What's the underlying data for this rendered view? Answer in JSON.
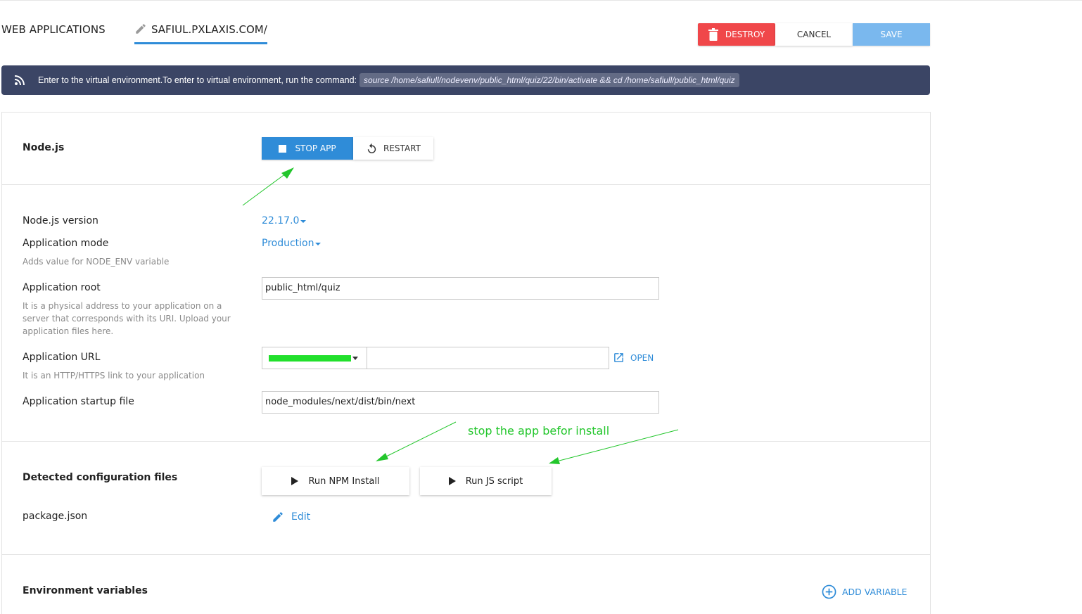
{
  "header": {
    "breadcrumb": "WEB APPLICATIONS",
    "domain": "SAFIUL.PXLAXIS.COM/",
    "destroy_label": "DESTROY",
    "cancel_label": "CANCEL",
    "save_label": "SAVE"
  },
  "banner": {
    "text": "Enter to the virtual environment.To enter to virtual environment, run the command:",
    "command": "source /home/safiull/nodevenv/public_html/quiz/22/bin/activate && cd /home/safiull/public_html/quiz"
  },
  "nodejs": {
    "title": "Node.js",
    "stop_label": "STOP APP",
    "restart_label": "RESTART"
  },
  "form": {
    "version_label": "Node.js version",
    "version_value": "22.17.0",
    "mode_label": "Application mode",
    "mode_value": "Production",
    "mode_hint": "Adds value for NODE_ENV variable",
    "root_label": "Application root",
    "root_value": "public_html/quiz",
    "root_hint": "It is a physical address to your application on a server that corresponds with its URI. Upload your application files here.",
    "url_label": "Application URL",
    "url_hint": "It is an HTTP/HTTPS link to your application",
    "url_path": "",
    "open_label": "OPEN",
    "startup_label": "Application startup file",
    "startup_value": "node_modules/next/dist/bin/next"
  },
  "config": {
    "title": "Detected configuration files",
    "npm_label": "Run NPM Install",
    "js_label": "Run JS script",
    "file_name": "package.json",
    "edit_label": "Edit"
  },
  "env": {
    "title": "Environment variables",
    "add_label": "ADD VARIABLE"
  },
  "annotation": {
    "text": "stop the app befor install"
  },
  "colors": {
    "primary": "#2f8cd8",
    "danger": "#f0474a",
    "save_disabled": "#7ab8ee",
    "banner_bg": "#3b4565",
    "annotation": "#22c62b"
  }
}
